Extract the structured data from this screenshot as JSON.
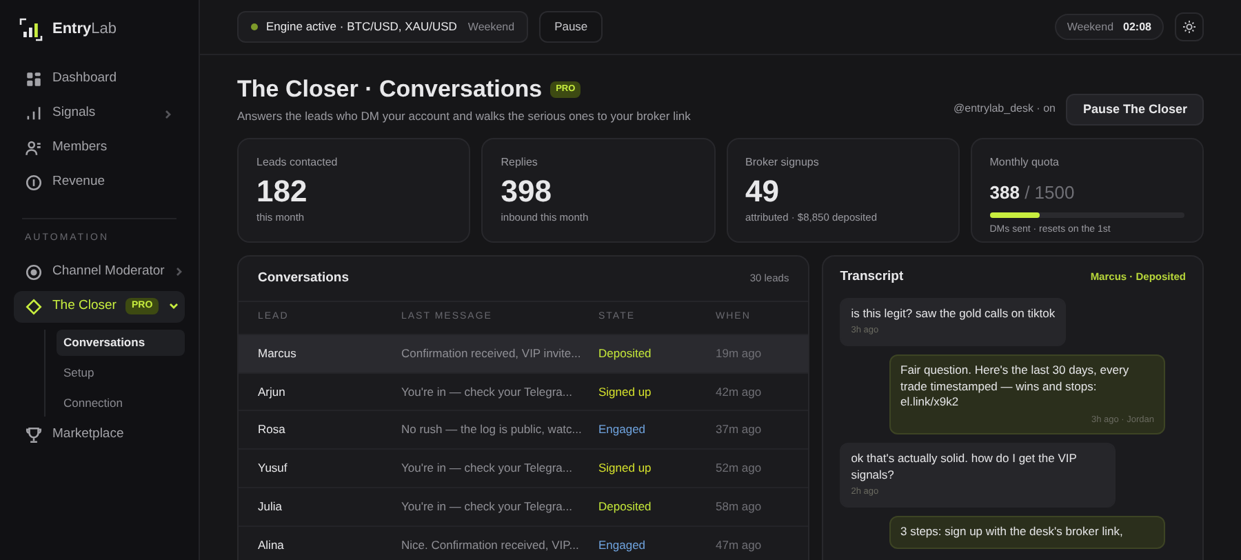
{
  "brand": {
    "bold": "Entry",
    "light": "Lab"
  },
  "sidebar": {
    "items": [
      {
        "label": "Dashboard",
        "selected": false,
        "chevron": false
      },
      {
        "label": "Signals",
        "selected": false,
        "chevron": true
      },
      {
        "label": "Members",
        "selected": false,
        "chevron": false
      },
      {
        "label": "Revenue",
        "selected": false,
        "chevron": false
      }
    ],
    "section": "AUTOMATION",
    "automation": [
      {
        "label": "Channel Moderator",
        "selected": false,
        "chevron": true
      },
      {
        "label": "The Closer",
        "selected": true,
        "badge": "PRO",
        "expanded": true,
        "children": [
          {
            "label": "Conversations",
            "selected": true
          },
          {
            "label": "Setup",
            "selected": false
          },
          {
            "label": "Connection",
            "selected": false
          }
        ]
      },
      {
        "label": "Marketplace",
        "selected": false,
        "chevron": false
      }
    ]
  },
  "topbar": {
    "engine": "Engine active · BTC/USD, XAU/USD",
    "session": "Weekend",
    "pause": "Pause",
    "clock_label": "Weekend",
    "clock": "02:08"
  },
  "header": {
    "title": "The Closer · Conversations",
    "badge": "PRO",
    "subtitle": "Answers the leads who DM your account and walks the serious ones to your broker link",
    "account": "@entrylab_desk · on",
    "button": "Pause The Closer"
  },
  "stats": [
    {
      "kind": "number",
      "label": "Leads contacted",
      "value": "182",
      "note": "this month"
    },
    {
      "kind": "number",
      "label": "Replies",
      "value": "398",
      "note": "inbound this month"
    },
    {
      "kind": "number",
      "label": "Broker signups",
      "value": "49",
      "note": "attributed · $8,850 deposited"
    },
    {
      "kind": "quota",
      "label": "Monthly quota",
      "value": "388",
      "total": "/ 1500",
      "level": 0.26,
      "note": "DMs sent · resets on the 1st"
    }
  ],
  "conversations": {
    "title": "Conversations",
    "count": "30 leads",
    "columns": [
      "LEAD",
      "LAST MESSAGE",
      "STATE",
      "WHEN"
    ],
    "rows": [
      {
        "lead": "Marcus",
        "message": "Confirmation received, VIP invite...",
        "state": "Deposited",
        "color": "#c5e83a",
        "when": "19m ago",
        "selected": true
      },
      {
        "lead": "Arjun",
        "message": "You're in — check your Telegra...",
        "state": "Signed up",
        "color": "#d4e02c",
        "when": "42m ago",
        "selected": false
      },
      {
        "lead": "Rosa",
        "message": "No rush — the log is public, watc...",
        "state": "Engaged",
        "color": "#6fa3de",
        "when": "37m ago",
        "selected": false
      },
      {
        "lead": "Yusuf",
        "message": "You're in — check your Telegra...",
        "state": "Signed up",
        "color": "#d4e02c",
        "when": "52m ago",
        "selected": false
      },
      {
        "lead": "Julia",
        "message": "You're in — check your Telegra...",
        "state": "Deposited",
        "color": "#c5e83a",
        "when": "58m ago",
        "selected": false
      },
      {
        "lead": "Alina",
        "message": "Nice. Confirmation received, VIP...",
        "state": "Engaged",
        "color": "#6fa3de",
        "when": "47m ago",
        "selected": false
      }
    ]
  },
  "transcript": {
    "title": "Transcript",
    "tag": "Marcus · Deposited",
    "messages": [
      {
        "kind": "in",
        "text": "is this legit? saw the gold calls on tiktok",
        "meta": "3h ago"
      },
      {
        "kind": "out",
        "text": "Fair question. Here's the last 30 days, every trade timestamped — wins and stops: el.link/x9k2",
        "meta": "3h ago · Jordan"
      },
      {
        "kind": "in",
        "text": "ok that's actually solid. how do I get the VIP signals?",
        "meta": "2h ago"
      },
      {
        "kind": "out",
        "text": "3 steps: sign up with the desk's broker link,"
      }
    ]
  }
}
